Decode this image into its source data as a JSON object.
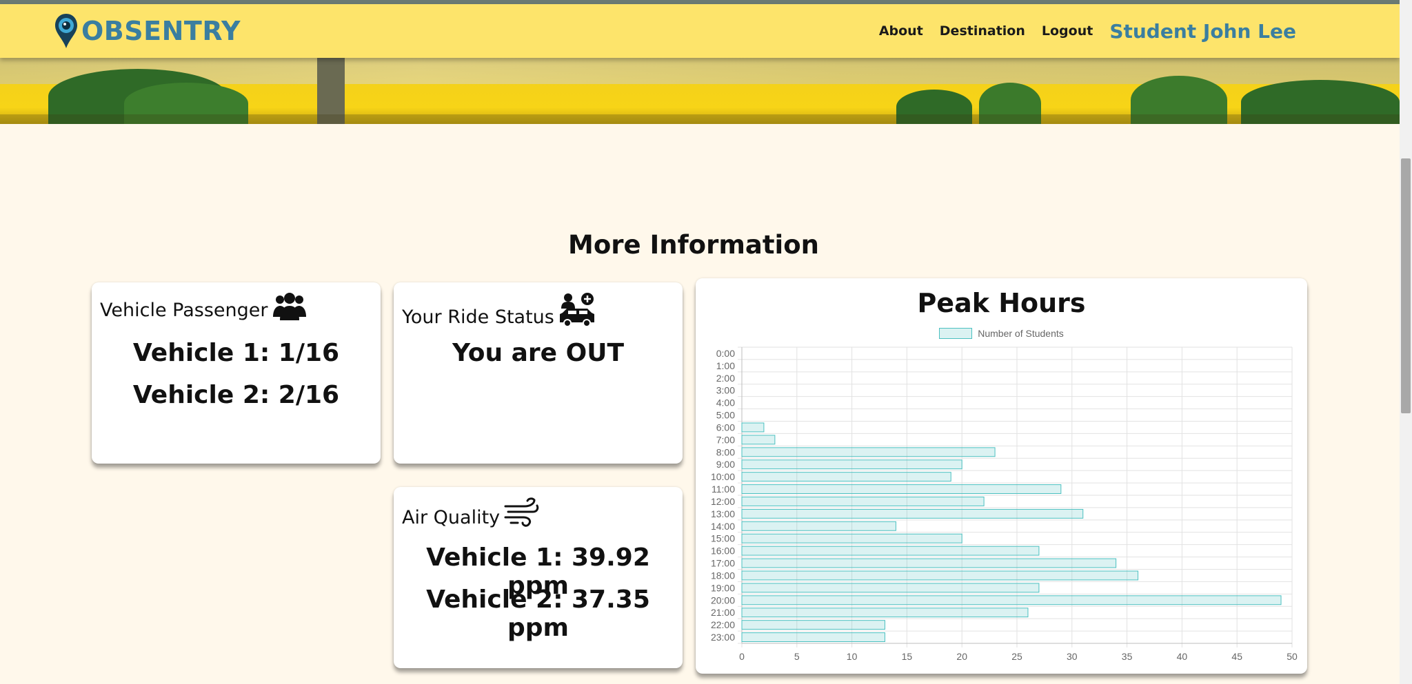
{
  "brand": {
    "name": "OBSENTRY"
  },
  "nav": {
    "links": [
      "About",
      "Destination",
      "Logout"
    ],
    "user": "Student John Lee"
  },
  "main": {
    "section_title": "More Information",
    "cards": {
      "passenger": {
        "title": "Vehicle Passenger",
        "icon": "users-icon",
        "lines": [
          "Vehicle 1: 1/16",
          "Vehicle 2: 2/16"
        ]
      },
      "ride": {
        "title": "Your Ride Status",
        "icon": "car-person-icon",
        "status": "You are OUT"
      },
      "air": {
        "title": "Air Quality",
        "icon": "wind-icon",
        "lines": [
          "Vehicle 1: 39.92 ppm",
          "Vehicle 2: 37.35 ppm"
        ]
      }
    }
  },
  "colors": {
    "navbar": "#fde46b",
    "brand": "#3a7ea0",
    "bar_fill": "rgba(75,192,192,0.2)",
    "bar_border": "#4bc0c0",
    "background": "#fff8eb"
  },
  "chart_data": {
    "type": "bar",
    "orientation": "horizontal",
    "title": "Peak Hours",
    "categories": [
      "0:00",
      "1:00",
      "2:00",
      "3:00",
      "4:00",
      "5:00",
      "6:00",
      "7:00",
      "8:00",
      "9:00",
      "10:00",
      "11:00",
      "12:00",
      "13:00",
      "14:00",
      "15:00",
      "16:00",
      "17:00",
      "18:00",
      "19:00",
      "20:00",
      "21:00",
      "22:00",
      "23:00"
    ],
    "series": [
      {
        "name": "Number of Students",
        "values": [
          0,
          0,
          0,
          0,
          0,
          0,
          2,
          3,
          23,
          20,
          19,
          29,
          22,
          31,
          14,
          20,
          27,
          34,
          36,
          27,
          49,
          26,
          13,
          13
        ]
      }
    ],
    "xlim": [
      0,
      50
    ],
    "xticks": [
      0,
      5,
      10,
      15,
      20,
      25,
      30,
      35,
      40,
      45,
      50
    ],
    "grid": true,
    "legend": "top"
  }
}
